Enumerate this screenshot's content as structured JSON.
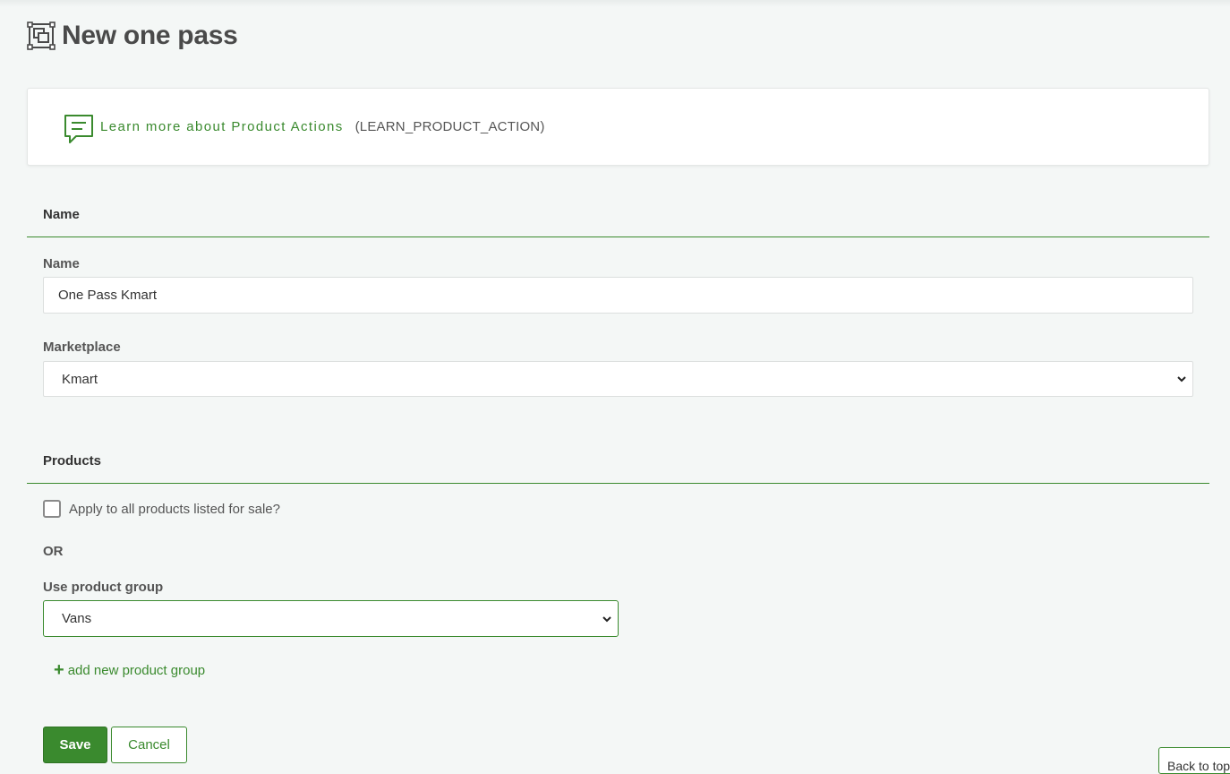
{
  "page": {
    "title": "New one pass",
    "icon": "product-actions-icon"
  },
  "info": {
    "link_label": "Learn more about Product Actions",
    "code": "(LEARN_PRODUCT_ACTION)",
    "icon": "chat-bubble-icon"
  },
  "name_section": {
    "title": "Name",
    "name_label": "Name",
    "name_value": "One Pass Kmart",
    "marketplace_label": "Marketplace",
    "marketplace_value": "Kmart"
  },
  "products_section": {
    "title": "Products",
    "apply_all_label": "Apply to all products listed for sale?",
    "apply_all_checked": false,
    "or_label": "OR",
    "group_label": "Use product group",
    "group_value": "Vans",
    "add_group_label": "add new product group"
  },
  "actions": {
    "save_label": "Save",
    "cancel_label": "Cancel"
  },
  "back_to_top_label": "Back to top",
  "colors": {
    "accent": "#3a8a2e",
    "background": "#f4f7f6"
  }
}
